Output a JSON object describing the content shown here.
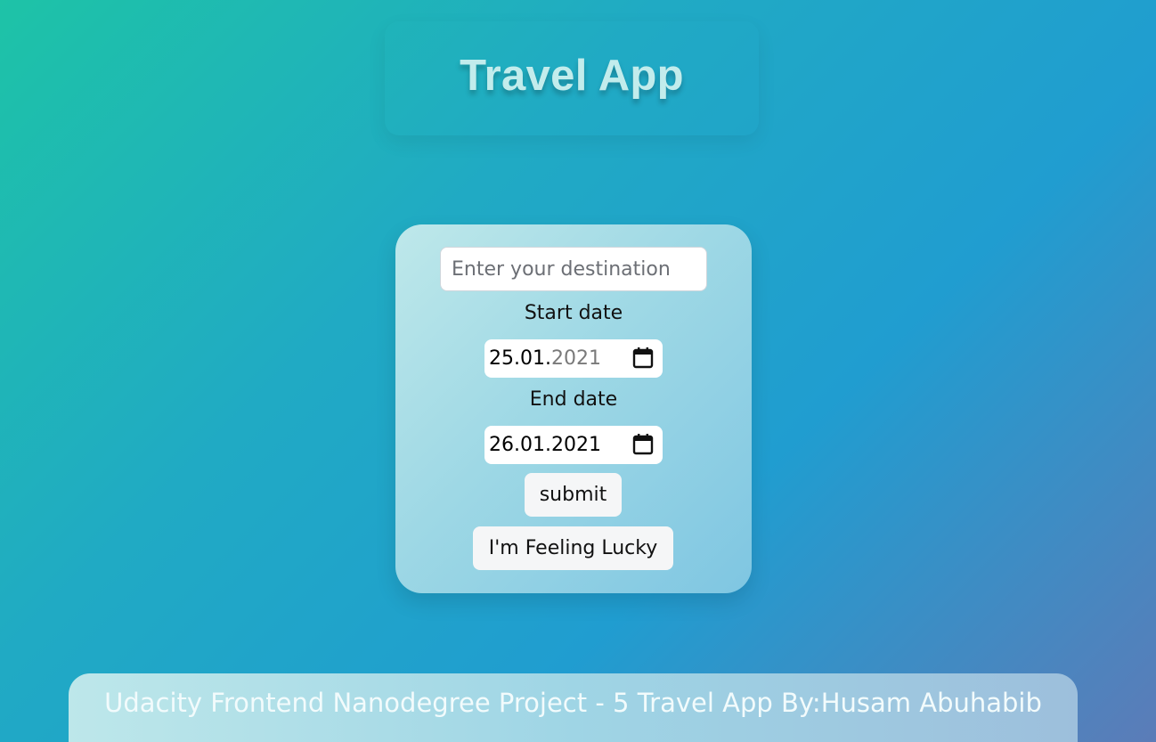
{
  "header": {
    "title": "Travel App"
  },
  "form": {
    "destination": {
      "value": "",
      "placeholder": "Enter your destination"
    },
    "start_date": {
      "label": "Start date",
      "day_month": "25.01.",
      "year": "2021"
    },
    "end_date": {
      "label": "End date",
      "value": "26.01.2021"
    },
    "calendar_icon": "calendar-icon",
    "submit_label": "submit",
    "lucky_label": "I'm Feeling Lucky"
  },
  "footer": {
    "text": "Udacity Frontend Nanodegree Project - 5 Travel App By:Husam Abuhabib"
  },
  "colors": {
    "background_start": "#1ec3a7",
    "background_mid": "#209dd0",
    "background_end": "#5b7cb8",
    "title": "#c2ecec",
    "card_light": "#bee8ea",
    "card_dark": "#7fc6e2"
  }
}
